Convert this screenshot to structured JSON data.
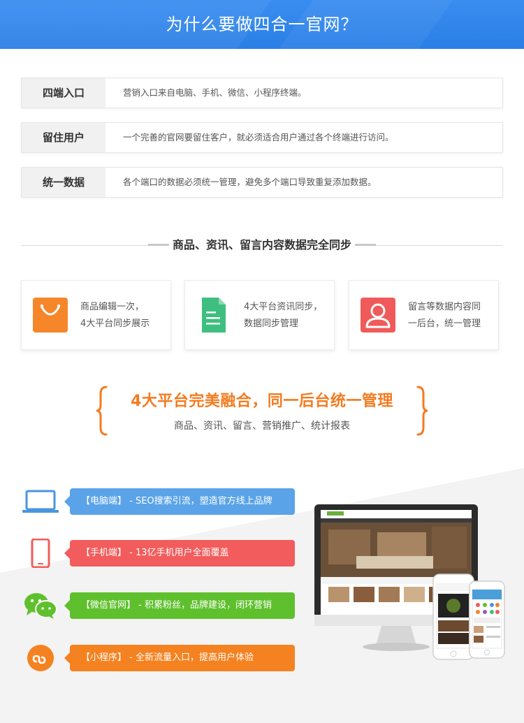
{
  "banner": {
    "title": "为什么要做四合一官网？"
  },
  "rows": [
    {
      "key": "四端入口",
      "value": "营销入口来自电脑、手机、微信、小程序终端。"
    },
    {
      "key": "留住用户",
      "value": "一个完善的官网要留住客户，就必须适合用户通过各个终端进行访问。"
    },
    {
      "key": "统一数据",
      "value": "各个端口的数据必须统一管理，避免多个端口导致重复添加数据。"
    }
  ],
  "sync": {
    "title": "商品、资讯、留言内容数据完全同步",
    "cards": [
      {
        "icon": "shopping-bag-icon",
        "color": "#f5862a",
        "line1": "商品编辑一次，",
        "line2": "4大平台同步展示"
      },
      {
        "icon": "document-icon",
        "color": "#3fbf7f",
        "line1": "4大平台资讯同步，",
        "line2": "数据同步管理"
      },
      {
        "icon": "user-icon",
        "color": "#f05a5a",
        "line1": "留言等数据内容同",
        "line2": "一后台，统一管理"
      }
    ]
  },
  "slogan": {
    "headline": "4大平台完美融合，同一后台统一管理",
    "subline": "商品、资讯、留言、营销推广、统计报表",
    "color": "#f47b20"
  },
  "platforms": [
    {
      "icon": "laptop-icon",
      "color": "#5aa3e8",
      "name": "【电脑端】",
      "desc": " - SEO搜索引流，塑造官方线上品牌"
    },
    {
      "icon": "mobile-phone-icon",
      "color": "#f25c5c",
      "name": "【手机端】",
      "desc": " - 13亿手机用户全面覆盖"
    },
    {
      "icon": "wechat-icon",
      "color": "#5fc02d",
      "name": "【微信官网】",
      "desc": " - 积累粉丝，品牌建设，闭环营销"
    },
    {
      "icon": "mini-program-icon",
      "color": "#f58220",
      "name": "【小程序】",
      "desc": " - 全新流量入口，提高用户体验"
    }
  ]
}
